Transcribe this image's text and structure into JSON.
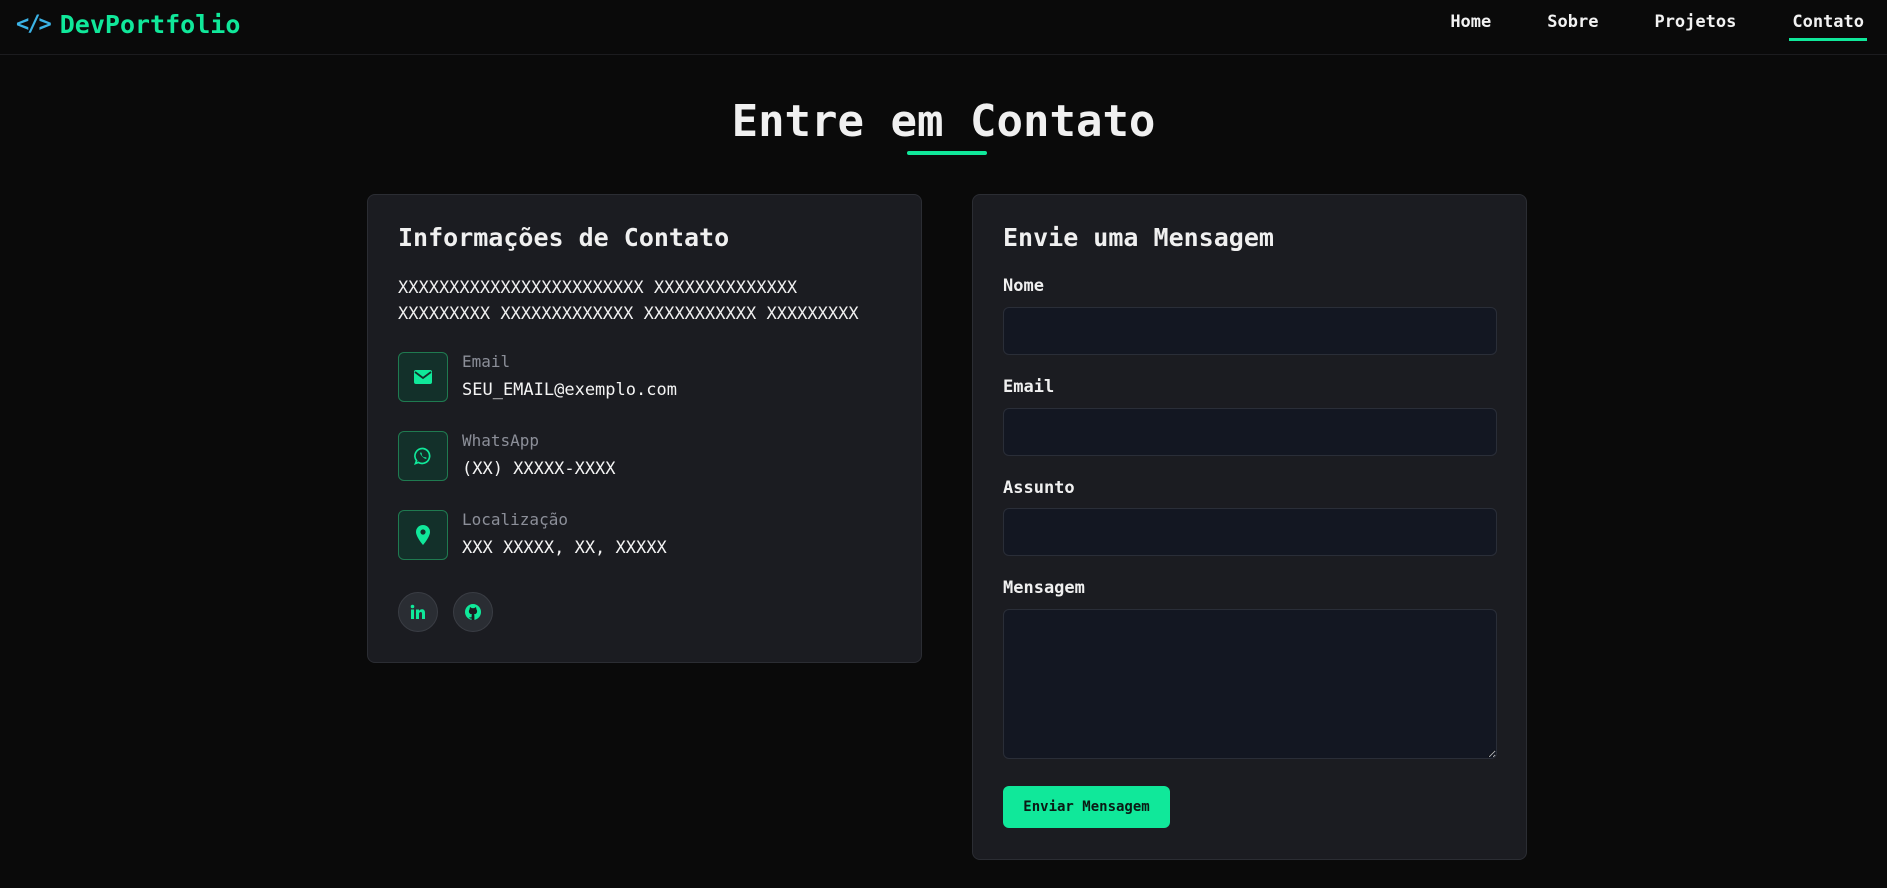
{
  "nav": {
    "logo_icon": "</>",
    "logo_text": "DevPortfolio",
    "links": [
      {
        "label": "Home"
      },
      {
        "label": "Sobre"
      },
      {
        "label": "Projetos"
      },
      {
        "label": "Contato",
        "active": true
      }
    ]
  },
  "page": {
    "title": "Entre em Contato"
  },
  "info": {
    "title": "Informações de Contato",
    "description": "XXXXXXXXXXXXXXXXXXXXXXXX XXXXXXXXXXXXXX XXXXXXXXX XXXXXXXXXXXXX XXXXXXXXXXX XXXXXXXXX",
    "items": [
      {
        "icon": "envelope-icon",
        "label": "Email",
        "value": "SEU_EMAIL@exemplo.com"
      },
      {
        "icon": "whatsapp-icon",
        "label": "WhatsApp",
        "value": "(XX) XXXXX-XXXX"
      },
      {
        "icon": "map-pin-icon",
        "label": "Localização",
        "value": "XXX XXXXX, XX, XXXXX"
      }
    ],
    "social": [
      {
        "icon": "linkedin-icon"
      },
      {
        "icon": "github-icon"
      }
    ]
  },
  "form": {
    "title": "Envie uma Mensagem",
    "fields": {
      "name": {
        "label": "Nome",
        "value": "",
        "placeholder": ""
      },
      "email": {
        "label": "Email",
        "value": "",
        "placeholder": ""
      },
      "subject": {
        "label": "Assunto",
        "value": "",
        "placeholder": ""
      },
      "message": {
        "label": "Mensagem",
        "value": "",
        "placeholder": ""
      }
    },
    "submit_label": "Enviar Mensagem"
  },
  "colors": {
    "accent": "#10e89a",
    "logo_icon": "#3bb3e6",
    "background": "#0a0a0a",
    "card": "#1b1c21",
    "input": "#131722"
  }
}
